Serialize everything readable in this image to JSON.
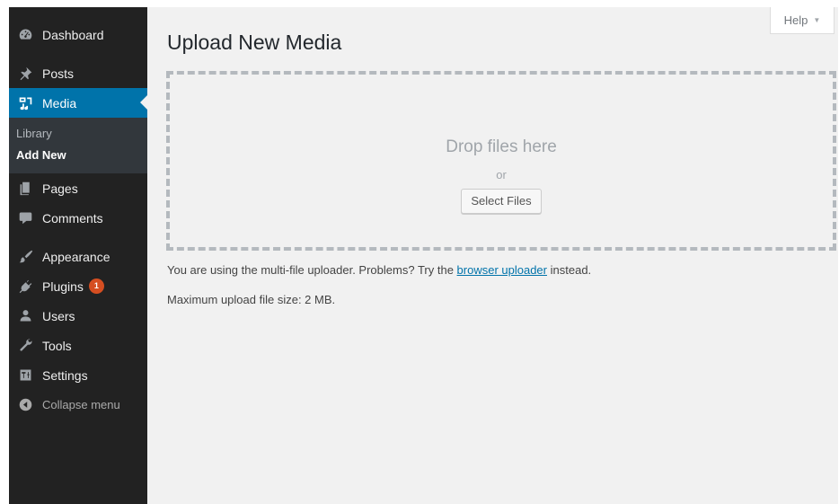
{
  "sidebar": {
    "items": [
      {
        "label": "Dashboard",
        "icon": "dashboard-icon"
      },
      {
        "label": "Posts",
        "icon": "pin-icon"
      },
      {
        "label": "Media",
        "icon": "media-icon",
        "active": true
      },
      {
        "label": "Pages",
        "icon": "page-icon"
      },
      {
        "label": "Comments",
        "icon": "comment-icon"
      },
      {
        "label": "Appearance",
        "icon": "brush-icon"
      },
      {
        "label": "Plugins",
        "icon": "plugin-icon",
        "badge": "1"
      },
      {
        "label": "Users",
        "icon": "user-icon"
      },
      {
        "label": "Tools",
        "icon": "wrench-icon"
      },
      {
        "label": "Settings",
        "icon": "settings-icon"
      }
    ],
    "media_submenu": [
      {
        "label": "Library"
      },
      {
        "label": "Add New",
        "current": true
      }
    ],
    "collapse_label": "Collapse menu"
  },
  "help": {
    "label": "Help",
    "caret": "▼"
  },
  "page": {
    "title": "Upload New Media"
  },
  "uploader": {
    "drop_text": "Drop files here",
    "or_text": "or",
    "select_button": "Select Files"
  },
  "info": {
    "multi_prefix": "You are using the multi-file uploader. Problems? Try the",
    "browser_link": "browser uploader",
    "multi_suffix": "instead.",
    "max_size": "Maximum upload file size: 2 MB."
  },
  "colors": {
    "sidebar_bg": "#222222",
    "active_bg": "#0073aa",
    "submenu_bg": "#32373c",
    "badge_bg": "#d54e21",
    "link": "#0073aa"
  }
}
